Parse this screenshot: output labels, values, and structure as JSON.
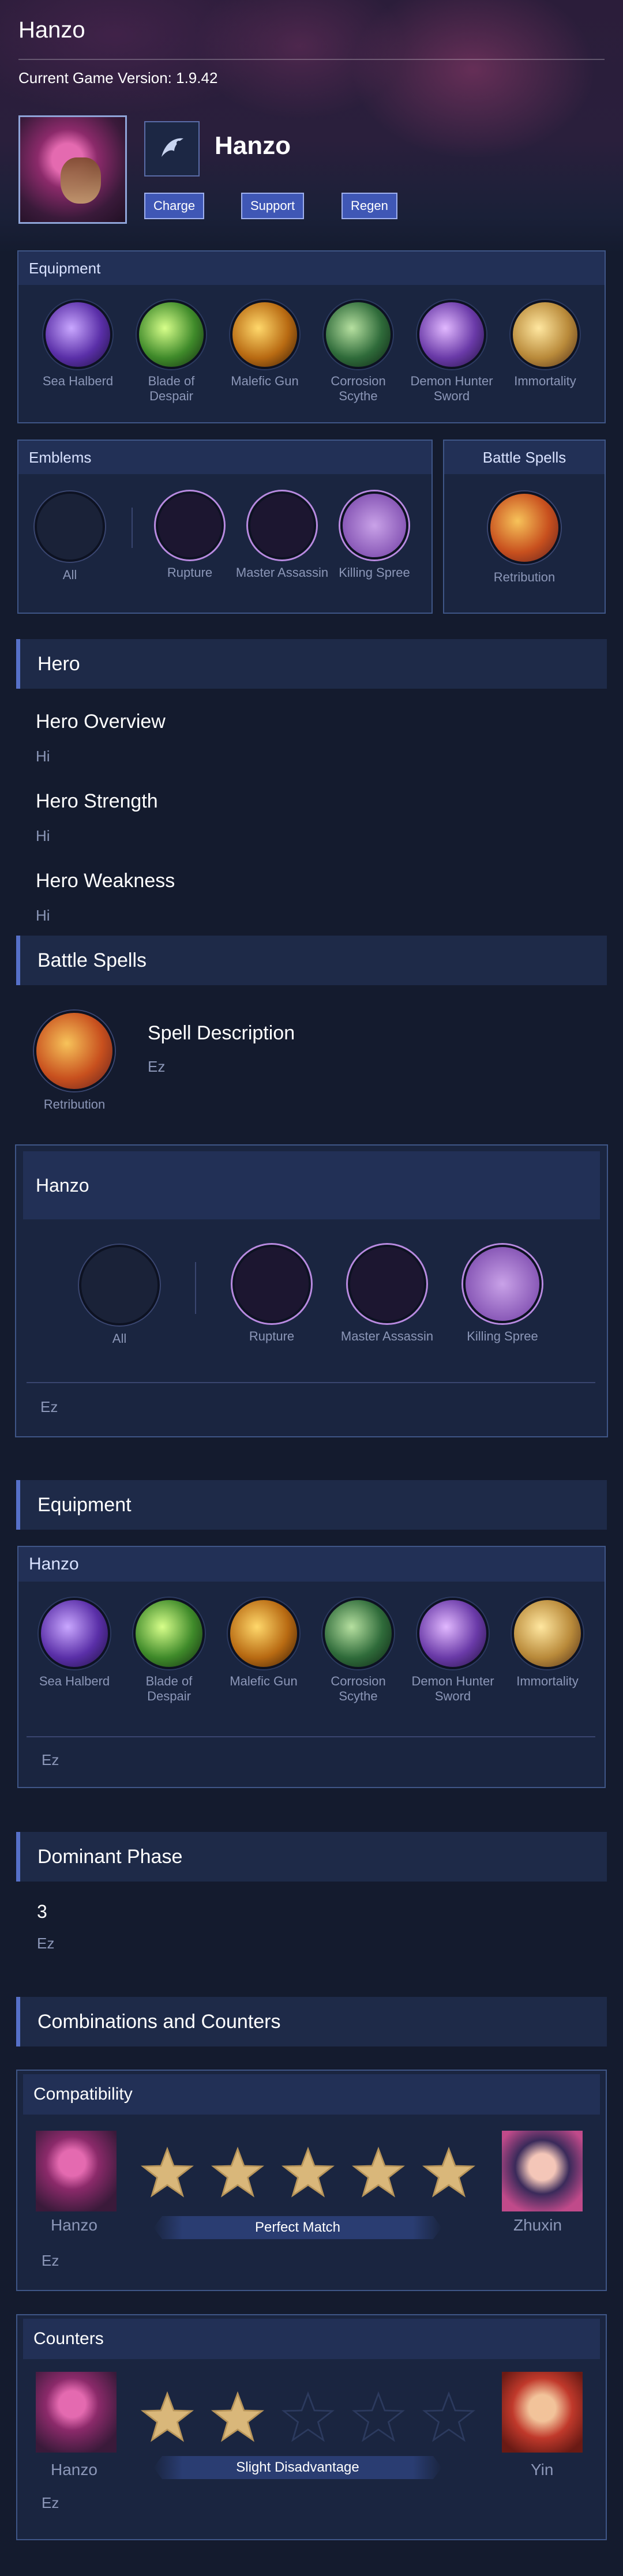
{
  "header": {
    "app_title": "Hanzo",
    "version_label": "Current Game Version: 1.9.42"
  },
  "hero": {
    "name": "Hanzo",
    "tags": [
      "Charge",
      "Support",
      "Regen"
    ]
  },
  "equipment_panel": {
    "title": "Equipment",
    "items": [
      "Sea Halberd",
      "Blade of Despair",
      "Malefic Gun",
      "Corrosion Scythe",
      "Demon Hunter Sword",
      "Immortality"
    ]
  },
  "emblems_panel": {
    "title": "Emblems",
    "main": "All",
    "talents": [
      "Rupture",
      "Master Assassin",
      "Killing Spree"
    ]
  },
  "battle_spells_panel": {
    "title": "Battle Spells",
    "spell": "Retribution"
  },
  "hero_section": {
    "title": "Hero",
    "overview_title": "Hero Overview",
    "overview_text": "Hi",
    "strength_title": "Hero Strength",
    "strength_text": "Hi",
    "weakness_title": "Hero Weakness",
    "weakness_text": "Hi"
  },
  "spells_section": {
    "title": "Battle Spells",
    "spell": "Retribution",
    "desc_title": "Spell Description",
    "desc_text": "Ez"
  },
  "emblem_card": {
    "title": "Hanzo",
    "main": "All",
    "talents": [
      "Rupture",
      "Master Assassin",
      "Killing Spree"
    ],
    "note": "Ez"
  },
  "equipment_section": {
    "title": "Equipment",
    "card_title": "Hanzo",
    "items": [
      "Sea Halberd",
      "Blade of Despair",
      "Malefic Gun",
      "Corrosion Scythe",
      "Demon Hunter Sword",
      "Immortality"
    ],
    "note": "Ez"
  },
  "dominant_phase": {
    "title": "Dominant Phase",
    "value": "3",
    "note": "Ez"
  },
  "combos": {
    "title": "Combinations and Counters",
    "compatibility": {
      "title": "Compatibility",
      "hero": "Hanzo",
      "partner": "Zhuxin",
      "rating": 5,
      "max_rating": 5,
      "verdict": "Perfect Match",
      "note": "Ez"
    },
    "counters": {
      "title": "Counters",
      "hero": "Hanzo",
      "opponent": "Yin",
      "rating": 2,
      "max_rating": 5,
      "verdict": "Slight Disadvantage",
      "note": "Ez"
    }
  },
  "colors": {
    "background": "#141b2e",
    "panel_border": "#3f5687",
    "accent": "#5670c8",
    "tag_bg": "#3f57b5",
    "muted_text": "#8c97b8",
    "star_gold": "#d9b77a"
  }
}
